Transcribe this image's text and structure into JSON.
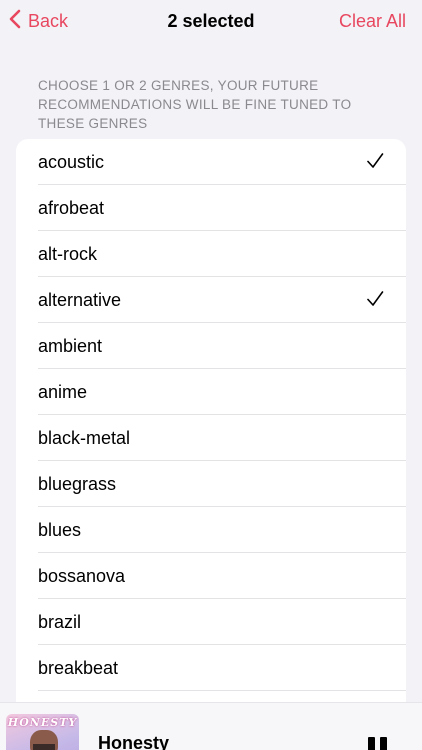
{
  "nav": {
    "back_label": "Back",
    "title": "2 selected",
    "clear_label": "Clear All"
  },
  "section_header": "Choose 1 or 2 genres, your future recommendations will be fine tuned to these genres",
  "genres": [
    {
      "label": "acoustic",
      "selected": true
    },
    {
      "label": "afrobeat",
      "selected": false
    },
    {
      "label": "alt-rock",
      "selected": false
    },
    {
      "label": "alternative",
      "selected": true
    },
    {
      "label": "ambient",
      "selected": false
    },
    {
      "label": "anime",
      "selected": false
    },
    {
      "label": "black-metal",
      "selected": false
    },
    {
      "label": "bluegrass",
      "selected": false
    },
    {
      "label": "blues",
      "selected": false
    },
    {
      "label": "bossanova",
      "selected": false
    },
    {
      "label": "brazil",
      "selected": false
    },
    {
      "label": "breakbeat",
      "selected": false
    }
  ],
  "player": {
    "artwork_text": "HONESTY",
    "track_title": "Honesty",
    "state_icon": "pause-icon"
  },
  "colors": {
    "accent": "#e8475f",
    "background": "#f2f2f7"
  }
}
